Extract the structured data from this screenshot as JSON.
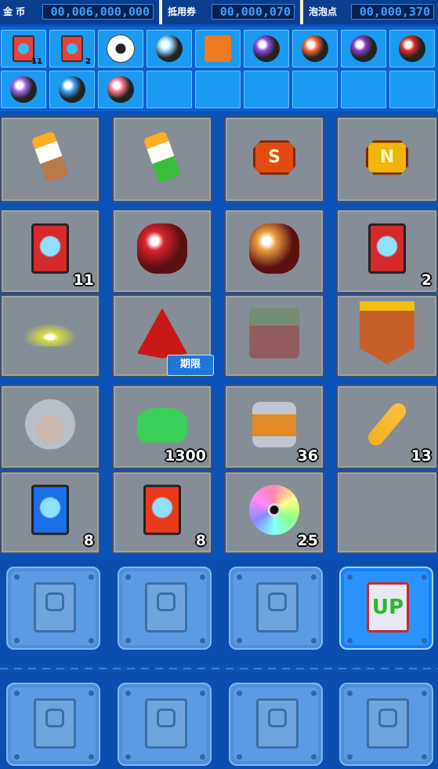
{
  "currencies": [
    {
      "label": "金 币",
      "value": "00,006,000,000"
    },
    {
      "label": "抵用券",
      "value": "00,000,070"
    },
    {
      "label": "泡泡点",
      "value": "00,000,370"
    }
  ],
  "quickslots": [
    {
      "icon": "bubble-card-icon",
      "color": "#e8413a",
      "count": "11"
    },
    {
      "icon": "bubble-card-icon",
      "color": "#e8413a",
      "count": "2"
    },
    {
      "icon": "soccer-ball-icon",
      "color": "#ffffff",
      "count": ""
    },
    {
      "icon": "world-ball-icon",
      "color": "#9ad8ff",
      "count": ""
    },
    {
      "icon": "orange-block-icon",
      "color": "#f07a20",
      "count": ""
    },
    {
      "icon": "rainbow-orb-icon",
      "color": "#8a4ce0",
      "count": ""
    },
    {
      "icon": "fire-orb-icon",
      "color": "#ff6a3a",
      "count": ""
    },
    {
      "icon": "purple-eye-orb-icon",
      "color": "#8c3cc8",
      "count": ""
    },
    {
      "icon": "red-orb-icon",
      "color": "#e82a2a",
      "count": ""
    },
    {
      "icon": "purple-bubble-icon",
      "color": "#a46cf0",
      "count": ""
    },
    {
      "icon": "blue-bubble-icon",
      "color": "#3aa8ff",
      "count": ""
    },
    {
      "icon": "pink-bubble-icon",
      "color": "#ff7a8a",
      "count": ""
    },
    {
      "icon": "",
      "color": "",
      "count": ""
    },
    {
      "icon": "",
      "color": "",
      "count": ""
    },
    {
      "icon": "",
      "color": "",
      "count": ""
    },
    {
      "icon": "",
      "color": "",
      "count": ""
    },
    {
      "icon": "",
      "color": "",
      "count": ""
    },
    {
      "icon": "",
      "color": "",
      "count": ""
    }
  ],
  "inventory": [
    {
      "icon": "brown-candle-icon",
      "count": ""
    },
    {
      "icon": "green-candle-icon",
      "count": ""
    },
    {
      "icon": "s-gem-icon",
      "count": ""
    },
    {
      "icon": "n-gem-icon",
      "count": ""
    },
    {
      "icon": "bubble-card-icon",
      "count": "11"
    },
    {
      "icon": "red-fortune-cookie-icon",
      "count": ""
    },
    {
      "icon": "orange-fortune-cookie-icon",
      "count": ""
    },
    {
      "icon": "bubble-card-icon",
      "count": "2"
    },
    {
      "icon": "splash-effect-icon",
      "count": ""
    },
    {
      "icon": "red-pyramid-icon",
      "count": ""
    },
    {
      "icon": "pirate-chest-icon",
      "count": ""
    },
    {
      "icon": "goal-banner-icon",
      "count": ""
    },
    {
      "icon": "girl-avatar-icon",
      "count": ""
    },
    {
      "icon": "green-powder-icon",
      "count": "1300"
    },
    {
      "icon": "tin-can-icon",
      "count": "36"
    },
    {
      "icon": "heart-key-icon",
      "count": "13"
    },
    {
      "icon": "blue-wing-card-icon",
      "count": "8"
    },
    {
      "icon": "gold-wing-card-icon",
      "count": "8"
    },
    {
      "icon": "cd-disc-icon",
      "count": "25"
    },
    {
      "icon": "",
      "count": ""
    }
  ],
  "limited_badge": "期限",
  "cards_row1": [
    {
      "icon": "s-card-icon",
      "active": false
    },
    {
      "icon": "superman-card-icon",
      "active": false
    },
    {
      "icon": "lion-card-icon",
      "active": false
    },
    {
      "icon": "up-card-icon",
      "active": true,
      "label": "UP"
    }
  ],
  "cards_row2": [
    {
      "icon": "key-card-icon",
      "active": false
    },
    {
      "icon": "speaker-card-icon",
      "active": false
    },
    {
      "icon": "health-card-icon",
      "active": false
    },
    {
      "icon": "coin-card-icon",
      "active": false
    }
  ]
}
